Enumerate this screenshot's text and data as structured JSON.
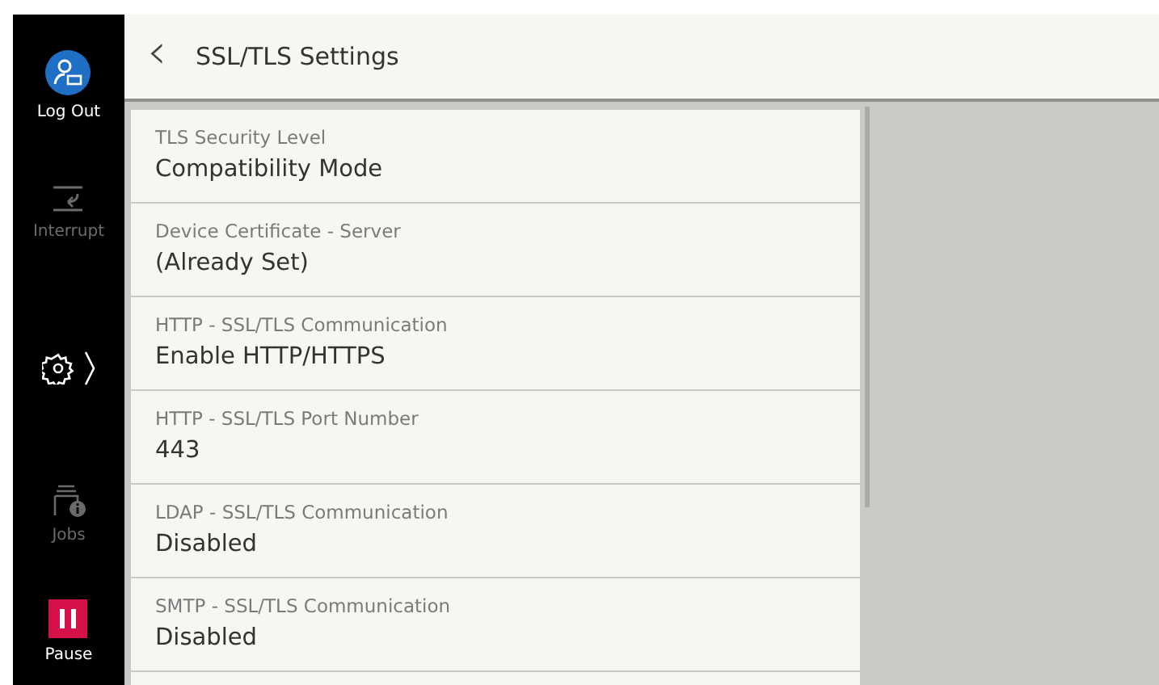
{
  "sidebar": {
    "items": [
      {
        "kind": "logout",
        "label": "Log Out",
        "disabled": false
      },
      {
        "kind": "interrupt",
        "label": "Interrupt",
        "disabled": true
      },
      {
        "kind": "settings",
        "disabled": false
      },
      {
        "kind": "jobs",
        "label": "Jobs",
        "disabled": true
      },
      {
        "kind": "pause",
        "label": "Pause",
        "disabled": false
      }
    ]
  },
  "header": {
    "back": "‹",
    "title": "SSL/TLS Settings"
  },
  "settings": [
    {
      "label": "TLS Security Level",
      "value": "Compatibility Mode"
    },
    {
      "label": "Device Certificate - Server",
      "value": "(Already Set)"
    },
    {
      "label": "HTTP - SSL/TLS Communication",
      "value": "Enable HTTP/HTTPS"
    },
    {
      "label": "HTTP - SSL/TLS Port Number",
      "value": "443"
    },
    {
      "label": "LDAP - SSL/TLS Communication",
      "value": "Disabled"
    },
    {
      "label": "SMTP - SSL/TLS Communication",
      "value": "Disabled"
    }
  ]
}
